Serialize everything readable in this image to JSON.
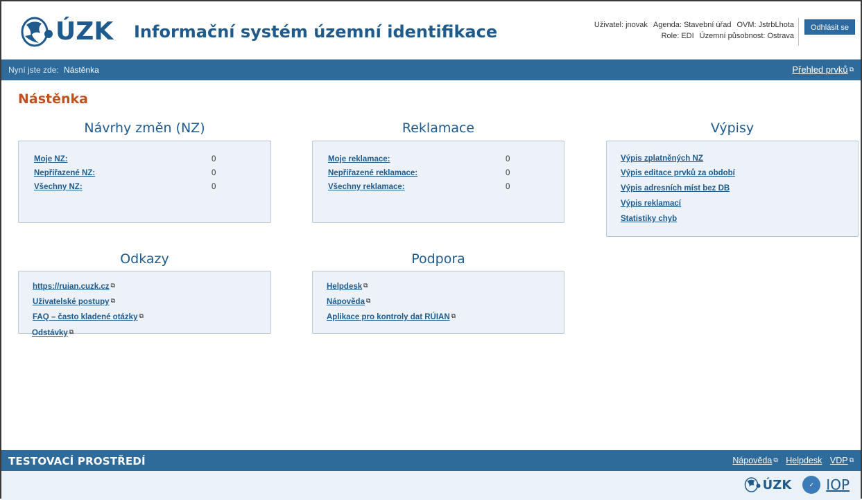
{
  "header": {
    "logo_text": "ÚZK",
    "app_title": "Informační systém územní identifikace",
    "user_line1": {
      "user": "Uživatel: jnovak",
      "agenda": "Agenda: Stavební úřad",
      "ovm": "OVM: JstrbLhota"
    },
    "user_line2": {
      "role": "Role: EDI",
      "scope": "Územní působnost: Ostrava"
    },
    "logout_label": "Odhlásit se"
  },
  "breadcrumb": {
    "prefix": "Nyní jste zde:",
    "current": "Nástěnka",
    "overview_link": "Přehled prvků"
  },
  "page_title": "Nástěnka",
  "sections": {
    "nz": {
      "heading": "Návrhy změn (NZ)",
      "rows": [
        {
          "label": "Moje NZ:",
          "value": "0"
        },
        {
          "label": "Nepřiřazené NZ:",
          "value": "0"
        },
        {
          "label": "Všechny NZ:",
          "value": "0"
        }
      ]
    },
    "reklamace": {
      "heading": "Reklamace",
      "rows": [
        {
          "label": "Moje reklamace:",
          "value": "0"
        },
        {
          "label": "Nepřiřazené reklamace:",
          "value": "0"
        },
        {
          "label": "Všechny reklamace:",
          "value": "0"
        }
      ]
    },
    "vypisy": {
      "heading": "Výpisy",
      "links": [
        "Výpis zplatněných NZ",
        "Výpis editace prvků za období",
        "Výpis adresních míst bez DB",
        "Výpis reklamací",
        "Statistiky chyb"
      ]
    },
    "odkazy": {
      "heading": "Odkazy",
      "links": [
        "https://ruian.cuzk.cz",
        "Uživatelské postupy",
        "FAQ – často kladené otázky",
        "Odstávky"
      ]
    },
    "podpora": {
      "heading": "Podpora",
      "links": [
        "Helpdesk",
        "Nápověda",
        "Aplikace pro kontroly dat RÚIAN"
      ]
    }
  },
  "footer": {
    "environment": "TESTOVACÍ PROSTŘEDÍ",
    "links": [
      "Nápověda",
      "Helpdesk",
      "VDP"
    ],
    "logo_text": "ÚZK",
    "iop": "IOP"
  },
  "icons": {
    "external": "external-link-icon",
    "logo": "cuzk-lion-logo-icon"
  },
  "colors": {
    "brand_blue": "#1f5a8c",
    "bar_blue": "#2e6a9a",
    "title_orange": "#c0501e",
    "panel_bg": "#edf2f8"
  }
}
